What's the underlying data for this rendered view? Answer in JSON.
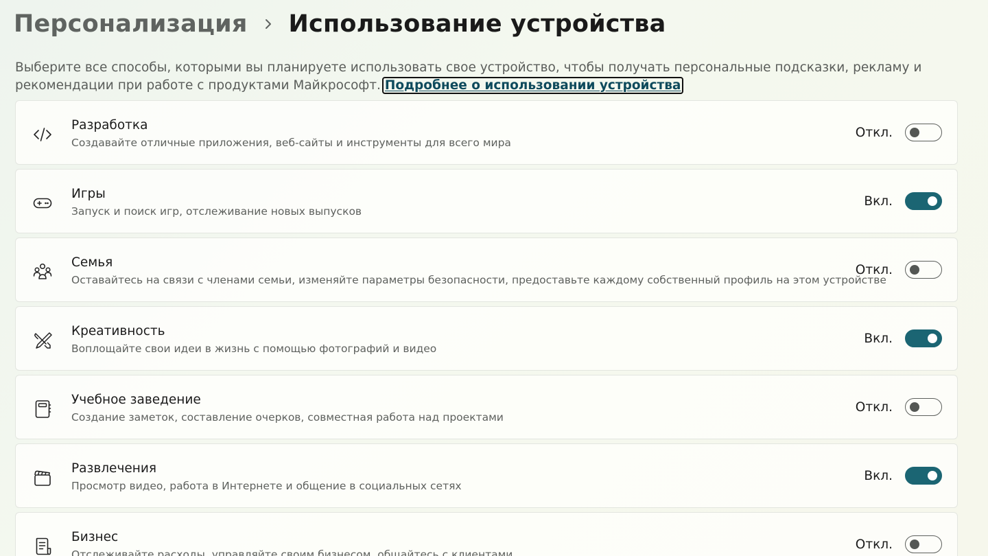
{
  "breadcrumb": {
    "parent": "Персонализация",
    "current": "Использование устройства"
  },
  "description": {
    "text": "Выберите все способы, которыми вы планируете использовать свое устройство, чтобы получать персональные подсказки, рекламу и рекомендации при работе с продуктами Майкрософт.",
    "link": "Подробнее о использовании устройства"
  },
  "items": [
    {
      "icon": "code-icon",
      "title": "Разработка",
      "subtitle": "Создавайте отличные приложения, веб-сайты и инструменты для всего мира",
      "state": "Откл.",
      "on": false
    },
    {
      "icon": "gamepad-icon",
      "title": "Игры",
      "subtitle": "Запуск и поиск игр, отслеживание новых выпусков",
      "state": "Вкл.",
      "on": true
    },
    {
      "icon": "family-icon",
      "title": "Семья",
      "subtitle": "Оставайтесь на связи с членами семьи, изменяйте параметры безопасности, предоставьте каждому собственный профиль на этом устройстве",
      "state": "Откл.",
      "on": false
    },
    {
      "icon": "brush-pencil-icon",
      "title": "Креативность",
      "subtitle": "Воплощайте свои идеи в жизнь с помощью фотографий и видео",
      "state": "Вкл.",
      "on": true
    },
    {
      "icon": "notebook-icon",
      "title": "Учебное заведение",
      "subtitle": "Создание заметок, составление очерков, совместная работа над проектами",
      "state": "Откл.",
      "on": false
    },
    {
      "icon": "clapperboard-icon",
      "title": "Развлечения",
      "subtitle": "Просмотр видео, работа в Интернете и общение в социальных сетях",
      "state": "Вкл.",
      "on": true
    },
    {
      "icon": "document-icon",
      "title": "Бизнес",
      "subtitle": "Отслеживайте расходы, управляйте своим бизнесом, общайтесь с клиентами",
      "state": "Откл.",
      "on": false
    }
  ],
  "colors": {
    "toggle_on": "#1b6573",
    "link": "#0e4a5c"
  }
}
